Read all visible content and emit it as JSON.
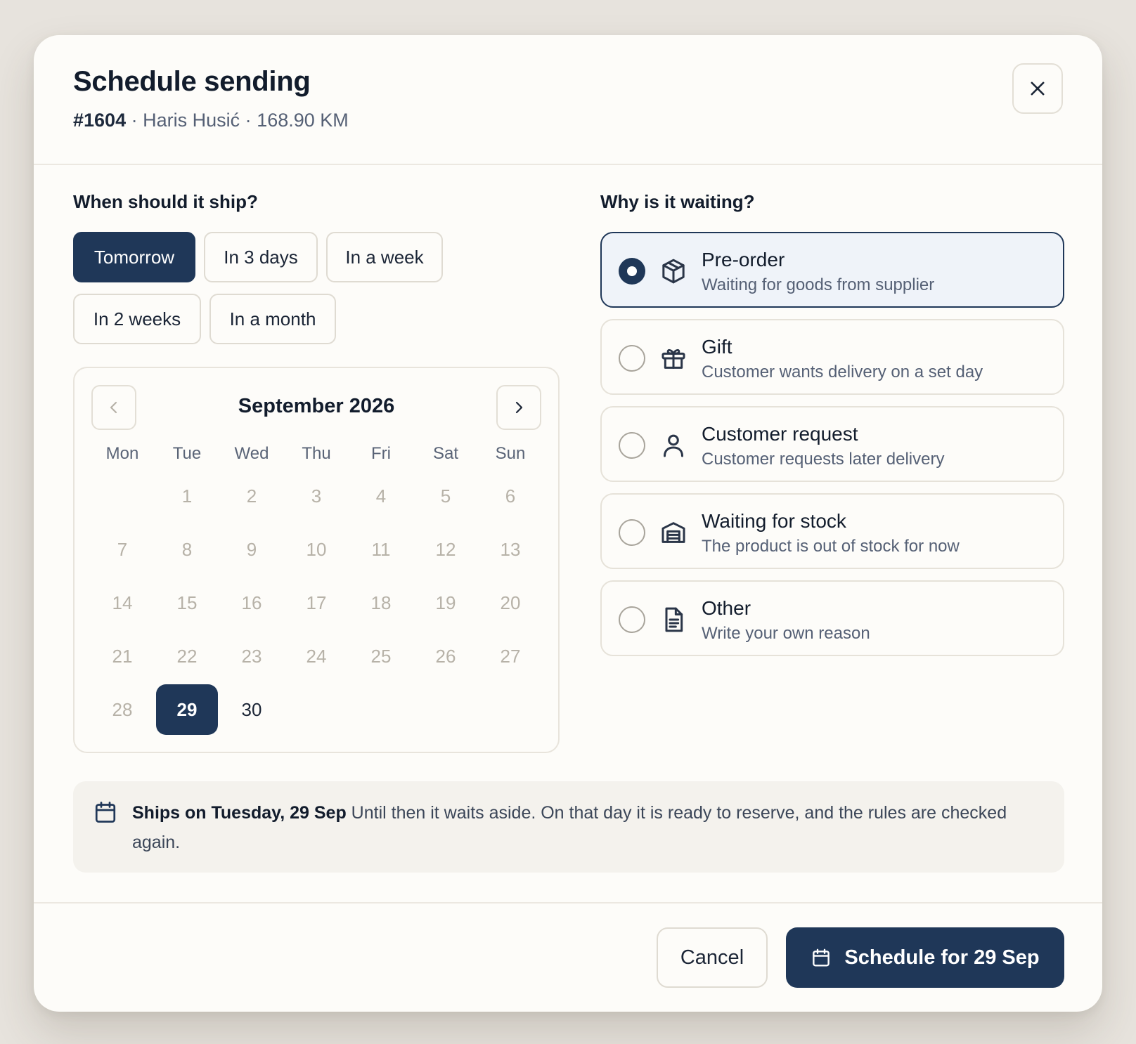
{
  "header": {
    "title": "Schedule sending",
    "order_id": "#1604",
    "separator": "·",
    "customer": "Haris Husić",
    "amount": "168.90 KM"
  },
  "when": {
    "label": "When should it ship?",
    "presets": [
      {
        "label": "Tomorrow",
        "selected": true
      },
      {
        "label": "In 3 days",
        "selected": false
      },
      {
        "label": "In a week",
        "selected": false
      },
      {
        "label": "In 2 weeks",
        "selected": false
      },
      {
        "label": "In a month",
        "selected": false
      }
    ]
  },
  "calendar": {
    "month_label": "September 2026",
    "weekdays": [
      "Mon",
      "Tue",
      "Wed",
      "Thu",
      "Fri",
      "Sat",
      "Sun"
    ],
    "days": [
      "1",
      "2",
      "3",
      "4",
      "5",
      "6",
      "7",
      "8",
      "9",
      "10",
      "11",
      "12",
      "13",
      "14",
      "15",
      "16",
      "17",
      "18",
      "19",
      "20",
      "21",
      "22",
      "23",
      "24",
      "25",
      "26",
      "27",
      "28",
      "29",
      "30"
    ],
    "first_weekday_index": 1,
    "selected_day": "29",
    "enabled_days": [
      "29",
      "30"
    ],
    "prev_icon": "chevron-left-icon",
    "next_icon": "chevron-right-icon"
  },
  "reasons": {
    "label": "Why is it waiting?",
    "items": [
      {
        "title": "Pre-order",
        "description": "Waiting for goods from supplier",
        "icon": "package-icon",
        "selected": true
      },
      {
        "title": "Gift",
        "description": "Customer wants delivery on a set day",
        "icon": "gift-icon",
        "selected": false
      },
      {
        "title": "Customer request",
        "description": "Customer requests later delivery",
        "icon": "user-icon",
        "selected": false
      },
      {
        "title": "Waiting for stock",
        "description": "The product is out of stock for now",
        "icon": "warehouse-icon",
        "selected": false
      },
      {
        "title": "Other",
        "description": "Write your own reason",
        "icon": "document-icon",
        "selected": false
      }
    ]
  },
  "notice": {
    "icon": "calendar-icon",
    "heading": "Ships on Tuesday, 29 Sep",
    "text": "Until then it waits aside. On that day it is ready to reserve, and the rules are checked again."
  },
  "footer": {
    "cancel_label": "Cancel",
    "submit_label": "Schedule for 29 Sep",
    "submit_icon": "calendar-icon"
  },
  "colors": {
    "primary": "#1f3758",
    "background": "#e7e3dd",
    "surface": "#fdfcf9",
    "selected_surface": "#eff3f9",
    "muted_text": "#556075",
    "disabled_day": "#b7b2a8"
  }
}
